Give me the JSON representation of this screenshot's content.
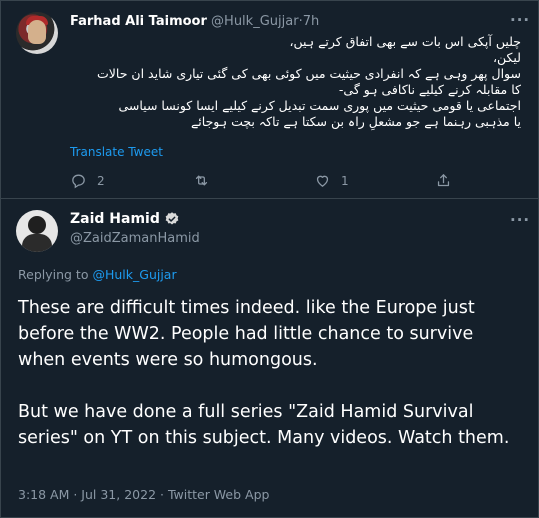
{
  "reply_tweet": {
    "author_name": "Farhad Ali Taimoor",
    "handle": "@Hulk_Gujjar",
    "separator": "·",
    "time": "7h",
    "text_lines": [
      "چلیں آپکی اس بات سے بھی اتفاق کرتے ہیں،",
      "لیکن،",
      "سوال پھر وہی ہے کہ انفرادی حیثیت میں کوئی بھی کی گئی تیاری شاید ان حالات",
      "کا مقابلہ کرنے کیلیے ناکافی ہو گی-",
      "اجتماعی یا قومی حیثیت میں پوری سمت تبدیل کرنے کیلیے ایسا کونسا سیاسی",
      "یا مذہبی رہنما ہے جو مشعلِ راہ بن سکتا ہے تاکہ بچت ہوجائے"
    ],
    "translate_label": "Translate Tweet",
    "reply_count": "2",
    "retweet_count": "",
    "like_count": "1",
    "icons": [
      "more-icon",
      "reply-icon",
      "retweet-icon",
      "like-icon",
      "share-icon"
    ]
  },
  "main_tweet": {
    "author_name": "Zaid Hamid",
    "handle": "@ZaidZamanHamid",
    "replying_prefix": "Replying to",
    "replying_to": "@Hulk_Gujjar",
    "paragraph_1": "These are difficult times indeed. like the Europe just before the WW2. People had little chance to survive when events were so humongous.",
    "paragraph_2": "But we have done a full series \"Zaid Hamid Survival series\" on YT on this subject. Many videos. Watch them.",
    "timestamp": "3:18 AM · Jul 31, 2022 · Twitter Web App",
    "icons": [
      "verified-badge-icon",
      "more-icon"
    ]
  },
  "colors": {
    "background": "#15202b",
    "border": "#38444d",
    "text_primary": "#ffffff",
    "text_secondary": "#8b98a5",
    "accent": "#1d9bf0"
  }
}
